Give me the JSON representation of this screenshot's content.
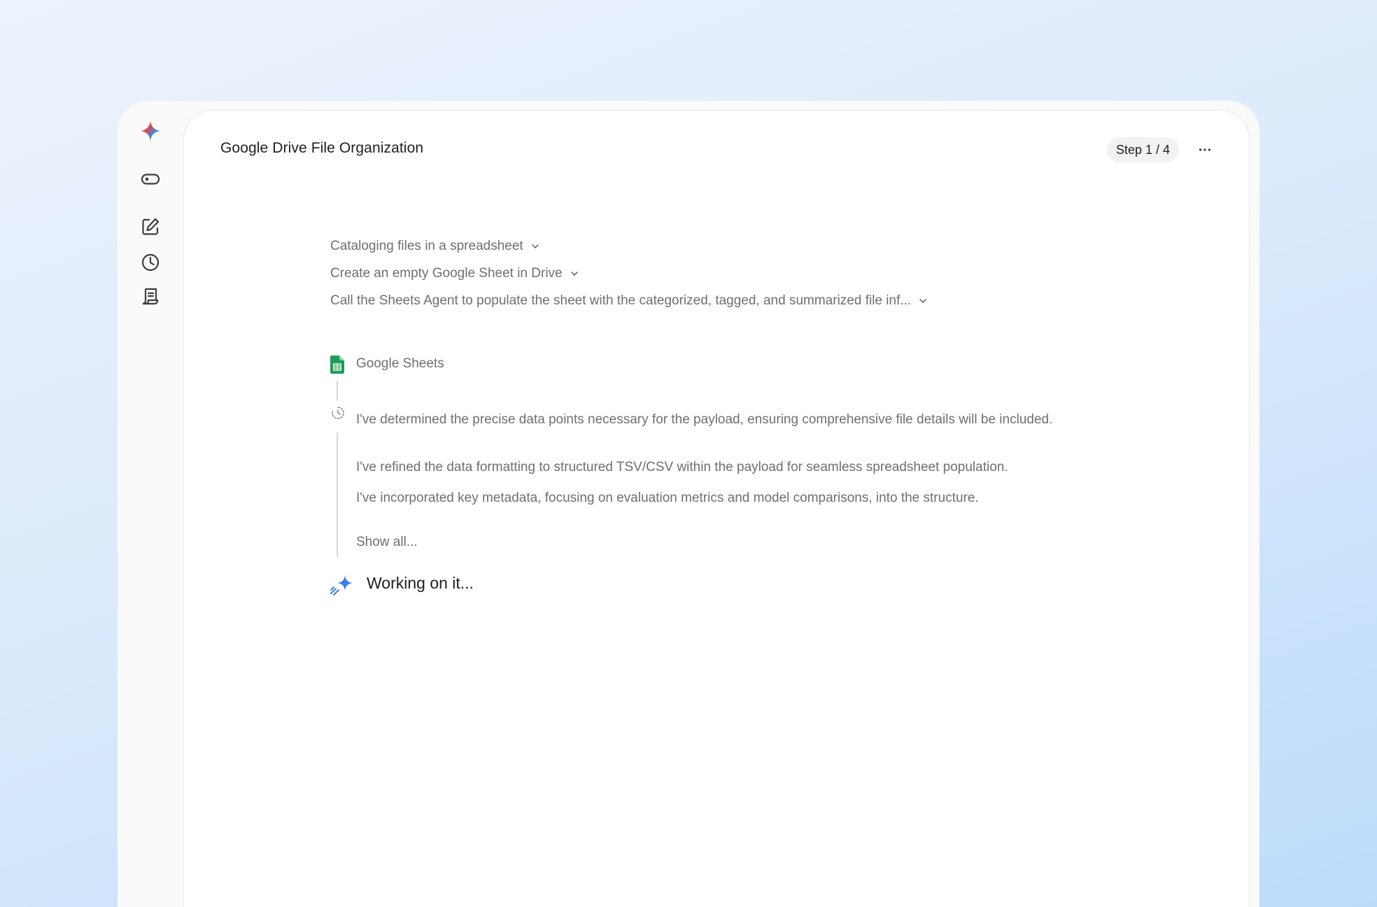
{
  "header": {
    "title": "Google Drive File Organization",
    "step_badge": "Step 1 / 4",
    "more_label": "⋯"
  },
  "rail": {
    "items": [
      {
        "icon": "gemini-spark-icon"
      },
      {
        "icon": "toggle-icon"
      },
      {
        "icon": "edit-icon"
      },
      {
        "icon": "history-icon"
      },
      {
        "icon": "receipt-icon"
      }
    ]
  },
  "steps": [
    {
      "label": "Cataloging files in a spreadsheet"
    },
    {
      "label": "Create an empty Google Sheet in Drive"
    },
    {
      "label": "Call the Sheets Agent to populate the sheet with the categorized, tagged, and summarized file inf..."
    }
  ],
  "tool": {
    "name": "Google Sheets",
    "icon": "google-sheets-icon"
  },
  "thoughts": [
    "I've determined the precise data points necessary for the payload, ensuring comprehensive file details will be included.",
    "I've refined the data formatting to structured TSV/CSV within the payload for seamless spreadsheet population.",
    "I've incorporated key metadata, focusing on evaluation metrics and model comparisons, into the structure."
  ],
  "show_all": "Show all...",
  "status": {
    "text": "Working on it...",
    "icon": "sparkle-working-icon"
  },
  "colors": {
    "accent_blue": "#3b7cf0",
    "sheets_green": "#1e9e5a",
    "muted_text": "#6f6f6f"
  }
}
